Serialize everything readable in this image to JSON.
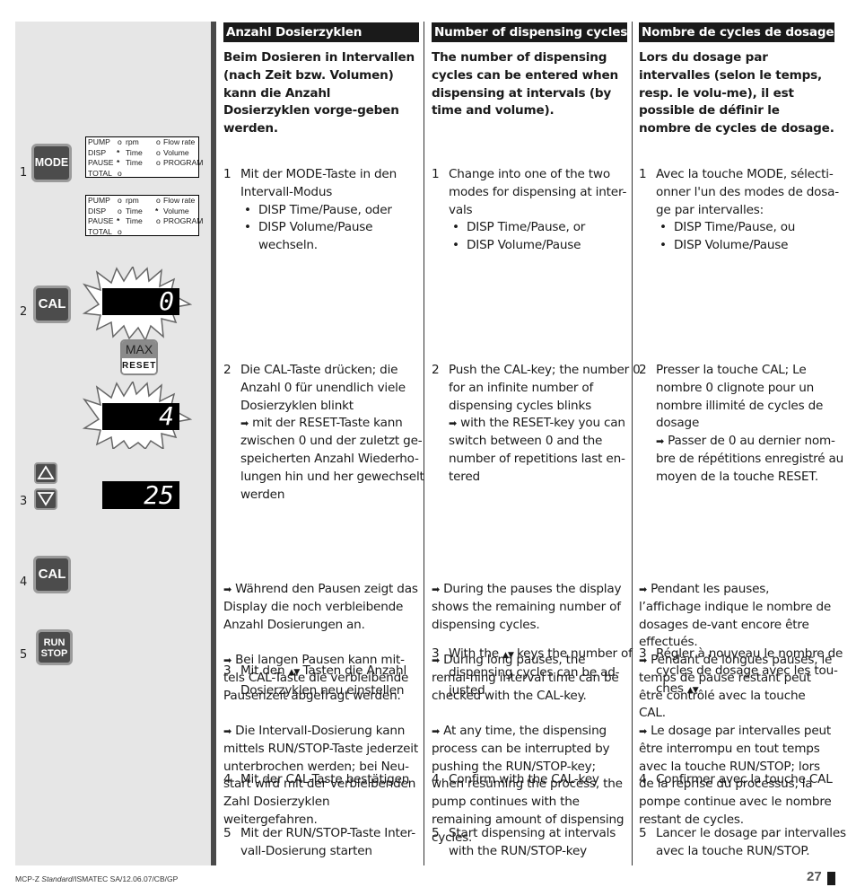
{
  "left_panel": {
    "steps": [
      "1",
      "2",
      "3",
      "4",
      "5"
    ],
    "keys": {
      "mode": "MODE",
      "cal": "CAL",
      "max": "MAX",
      "reset": "RESET",
      "run": "RUN",
      "stop": "STOP"
    },
    "status_boxes": [
      {
        "rows": [
          {
            "label": "PUMP",
            "ind1": "o",
            "opt1": "rpm",
            "ind2": "o",
            "opt2": "Flow rate"
          },
          {
            "label": "DISP",
            "ind1": "*",
            "opt1": "Time",
            "ind2": "o",
            "opt2": "Volume"
          },
          {
            "label": "PAUSE",
            "ind1": "*",
            "opt1": "Time",
            "ind2": "o",
            "opt2": "PROGRAM"
          },
          {
            "label": "TOTAL",
            "ind1": "o",
            "opt1": "",
            "ind2": "",
            "opt2": ""
          }
        ]
      },
      {
        "rows": [
          {
            "label": "PUMP",
            "ind1": "o",
            "opt1": "rpm",
            "ind2": "o",
            "opt2": "Flow rate"
          },
          {
            "label": "DISP",
            "ind1": "o",
            "opt1": "Time",
            "ind2": "*",
            "opt2": "Volume"
          },
          {
            "label": "PAUSE",
            "ind1": "*",
            "opt1": "Time",
            "ind2": "o",
            "opt2": "PROGRAM"
          },
          {
            "label": "TOTAL",
            "ind1": "o",
            "opt1": "",
            "ind2": "",
            "opt2": ""
          }
        ]
      }
    ],
    "displays": {
      "blink_zero": "0",
      "blink_four": "4",
      "static_25": "25"
    }
  },
  "columns": [
    {
      "lang": "de",
      "heading": "Anzahl Dosierzyklen",
      "intro": "Beim Dosieren in Intervallen (nach Zeit bzw. Volumen) kann die Anzahl Dosierzyklen vorge-geben werden.",
      "step1": {
        "num": "1",
        "text": "Mit der MODE-Taste in den Intervall-Modus",
        "bullets": [
          "DISP Time/Pause, oder",
          "DISP Volume/Pause"
        ],
        "after": "wechseln."
      },
      "step2": {
        "num": "2",
        "text": "Die CAL-Taste drücken; die Anzahl 0 für unendlich viele Dosierzyklen blinkt",
        "note": "mit der RESET-Taste kann zwischen 0 und der zuletzt ge-speicherten Anzahl Wiederho-lungen hin und her gewechselt werden"
      },
      "step3": {
        "num": "3",
        "pre": "Mit den",
        "post": "Tasten die Anzahl Dosierzyklen neu einstellen"
      },
      "step4": {
        "num": "4",
        "text": "Mit der CAL-Taste bestätigen"
      },
      "step5": {
        "num": "5",
        "text": "Mit der RUN/STOP-Taste Inter-vall-Dosierung starten"
      },
      "notes": [
        "Während den Pausen zeigt das Display die noch verbleibende Anzahl Dosierungen an.",
        "Bei langen Pausen kann mit-tels CAL-Taste die verbleibende Pausenzeit abgefragt werden.",
        "Die Intervall-Dosierung kann mittels RUN/STOP-Taste jederzeit unterbrochen werden; bei Neu-start wird mit der verbleibenden Zahl Dosierzyklen weitergefahren."
      ]
    },
    {
      "lang": "en",
      "heading": "Number of dispensing cycles",
      "intro": "The number of dispensing cycles can be entered when dispensing at intervals (by time and volume).",
      "step1": {
        "num": "1",
        "text": "Change into one of the two modes for dispensing at inter-vals",
        "bullets": [
          "DISP Time/Pause, or",
          "DISP Volume/Pause"
        ],
        "after": ""
      },
      "step2": {
        "num": "2",
        "text": "Push the CAL-key; the number 0 for an infinite number of dispensing cycles blinks",
        "note": "with the RESET-key you can switch between 0 and the number of repetitions last en-tered"
      },
      "step3": {
        "num": "3",
        "pre": "With the",
        "post": "keys the number of dispensing cycles can be ad-justed"
      },
      "step4": {
        "num": "4",
        "text": "Confirm with the CAL-key"
      },
      "step5": {
        "num": "5",
        "text": "Start dispensing at intervals with the RUN/STOP-key"
      },
      "notes": [
        "During the pauses the display shows the remaining number of dispensing cycles.",
        "During long pauses, the remai-ning interval time can be checked with the CAL-key.",
        "At any time, the dispensing process can be interrupted by pushing the RUN/STOP-key; when resuming the process, the pump continues with the remaining amount of dispensing cycles."
      ]
    },
    {
      "lang": "fr",
      "heading": "Nombre de cycles de dosage",
      "intro": "Lors du dosage par intervalles (selon le temps, resp. le volu-me), il est possible de définir le nombre de cycles de dosage.",
      "step1": {
        "num": "1",
        "text": "Avec la touche MODE, sélecti-onner l'un des modes de dosa-ge par intervalles:",
        "bullets": [
          "DISP Time/Pause, ou",
          "DISP Volume/Pause"
        ],
        "after": ""
      },
      "step2": {
        "num": "2",
        "text": "Presser la touche CAL; Le nombre 0 clignote pour un nombre illimité de cycles de dosage",
        "note": "Passer de 0 au dernier nom-bre de répétitions enregistré au moyen de la touche RESET."
      },
      "step3": {
        "num": "3",
        "pre": "Régler à nouveau le nombre de cycles de dosage avec les tou-ches",
        "post": ""
      },
      "step4": {
        "num": "4",
        "text": "Confirmer avec la touche CAL"
      },
      "step5": {
        "num": "5",
        "text": "Lancer le dosage par intervalles avec la touche RUN/STOP."
      },
      "notes": [
        "Pendant les pauses, l’affichage indique le nombre de dosages de-vant encore être effectués.",
        "Pendant de longues pauses,  le temps de pause restant peut être contrôlé avec la touche CAL.",
        "Le dosage par intervalles peut être interrompu en tout temps avec la touche RUN/STOP; lors de la reprise du processus, la pompe continue avec le nombre restant de cycles."
      ]
    }
  ],
  "symbols": {
    "arrow": "➡",
    "updown": "▲▼"
  },
  "footer": {
    "prefix": "MCP-Z ",
    "italic": "Standard",
    "suffix": "/ISMATEC SA/12.06.07/CB/GP",
    "page": "27"
  }
}
